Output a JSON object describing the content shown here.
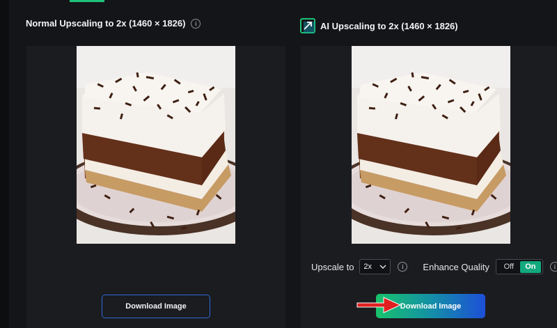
{
  "left_panel": {
    "title": "Normal Upscaling to 2x (1460 × 1826)",
    "download_label": "Download Image"
  },
  "right_panel": {
    "title": "AI Upscaling to 2x (1460 × 1826)",
    "upscale_label": "Upscale to",
    "upscale_value": "2x",
    "enhance_label": "Enhance Quality",
    "toggle_off_label": "Off",
    "toggle_on_label": "On",
    "enhance_on": true,
    "download_label": "Download Image"
  },
  "info_glyph": "i",
  "colors": {
    "accent_green": "#1ec27a",
    "outline_blue": "#2d6ad8",
    "toggle_on": "#13a97e",
    "gradient_start": "#18c36c",
    "gradient_end": "#1d4fd8",
    "annotation_arrow": "#e02020"
  },
  "icons": {
    "info": "info-circle-icon",
    "ai": "ai-upscale-icon",
    "select": "chevron-down-icon",
    "annotation": "red-arrow-annotation"
  },
  "images": {
    "left": "layered chocolate pudding dessert photo (normal upscale)",
    "right": "layered chocolate pudding dessert photo (AI upscale)"
  }
}
